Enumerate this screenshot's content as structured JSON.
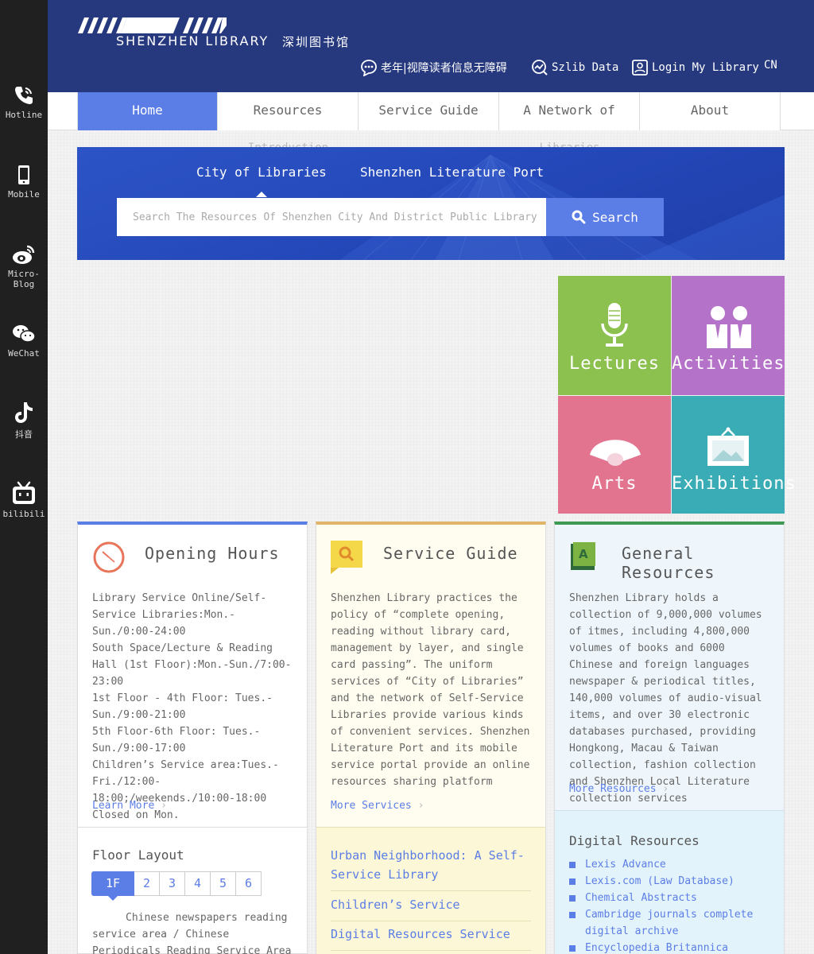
{
  "sidebar": {
    "items": [
      {
        "label": "Hotline",
        "icon": "phone-icon"
      },
      {
        "label": "Mobile",
        "icon": "mobile-icon"
      },
      {
        "label": "Micro-Blog",
        "icon": "weibo-icon"
      },
      {
        "label": "WeChat",
        "icon": "wechat-icon"
      },
      {
        "label": "抖音",
        "icon": "tiktok-icon"
      },
      {
        "label": "bilibili",
        "icon": "bilibili-icon"
      }
    ]
  },
  "header": {
    "logo_en": "SHENZHEN LIBRARY",
    "logo_cn": "深圳图书馆",
    "links": {
      "accessibility": "老年|视障读者信息无障碍",
      "szlib_data": "Szlib Data",
      "login": "Login My Library",
      "language": "CN"
    }
  },
  "nav": {
    "items": [
      "Home",
      "Resources",
      "Service Guide",
      "A Network of",
      "About"
    ],
    "overflow": [
      "Introduction",
      "Libraries"
    ]
  },
  "banner": {
    "tabs": [
      "City of Libraries",
      "Shenzhen Literature Port"
    ],
    "search_placeholder": "Search The Resources Of Shenzhen City And District Public Library",
    "search_button": "Search"
  },
  "tiles": {
    "lectures": "Lectures",
    "activities": "Activities",
    "arts": "Arts",
    "exhibitions": "Exhibitions"
  },
  "colors": {
    "header": "#27397e",
    "accent": "#5b7de6",
    "lectures": "#8cc04f",
    "activities": "#b572c9",
    "arts": "#e3748f",
    "exhibitions": "#3aacb6"
  },
  "opening_hours": {
    "title": "Opening Hours",
    "lines": [
      "Library Service Online/Self-Service Libraries:Mon.-Sun./0:00-24:00",
      "South Space/Lecture & Reading Hall (1st Floor):Mon.-Sun./7:00-23:00",
      "1st Floor - 4th Floor: Tues.-Sun./9:00-21:00",
      "5th Floor-6th Floor: Tues.-Sun./9:00-17:00",
      "Children’s Service area:Tues.-Fri./12:00-18:00;/weekends./10:00-18:00",
      "Closed on Mon."
    ],
    "more": "Learn More",
    "floor_title": "Floor Layout",
    "floors": [
      "1F",
      "2",
      "3",
      "4",
      "5",
      "6"
    ],
    "floor_text": "Chinese newspapers reading service area / Chinese Periodicals Reading Service Area / Periodicals"
  },
  "service_guide": {
    "title": "Service Guide",
    "body": "Shenzhen Library practices the policy of “complete opening, reading without library card, management by layer, and single card passing”. The uniform services of “City of Libraries” and the network of Self-Service Libraries provide various kinds of convenient services. Shenzhen Literature Port and its mobile service portal provide an online resources sharing platform",
    "more": "More Services",
    "links": [
      "Urban Neighborhood: A Self-Service Library",
      "Children’s Service",
      "Digital Resources Service"
    ]
  },
  "general_resources": {
    "title": "General Resources",
    "body": "Shenzhen Library holds a collection of 9,000,000 volumes of itmes, including 4,800,000 volumes of books and 6000 Chinese and foreign languages newspaper & periodical titles, 140,000 volumes of audio-visual items, and over 30 electronic databases purchased, providing Hongkong, Macau & Taiwan collection, fashion collection and Shenzhen Local Literature collection services",
    "more": "More Resources",
    "digital_title": "Digital Resources",
    "digital": [
      "Lexis Advance",
      "Lexis.com (Law Database)",
      "Chemical Abstracts",
      "Cambridge journals complete digital archive",
      "Encyclopedia Britannica"
    ]
  }
}
